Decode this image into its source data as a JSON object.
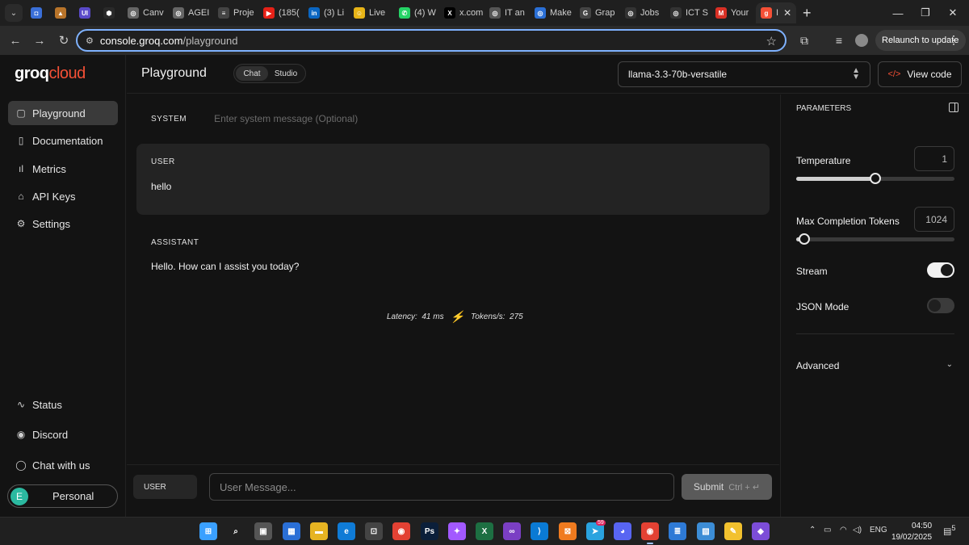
{
  "browser": {
    "tabs": [
      {
        "label": "",
        "color": "#3a6fd8",
        "glyph": "◘"
      },
      {
        "label": "",
        "color": "#b8742a",
        "glyph": "▲"
      },
      {
        "label": "",
        "color": "#5a4ac9",
        "glyph": "UI"
      },
      {
        "label": "",
        "color": "#2a2a2a",
        "glyph": "⬢"
      },
      {
        "label": "Canv",
        "color": "#666666",
        "glyph": "◎"
      },
      {
        "label": "AGEI",
        "color": "#666666",
        "glyph": "◎"
      },
      {
        "label": "Proje",
        "color": "#444444",
        "glyph": "≡"
      },
      {
        "label": "(185(",
        "color": "#e62117",
        "glyph": "▶"
      },
      {
        "label": "(3) Li",
        "color": "#0a66c2",
        "glyph": "in"
      },
      {
        "label": "Live",
        "color": "#e7b417",
        "glyph": "☺"
      },
      {
        "label": "(4) W",
        "color": "#25d366",
        "glyph": "✆"
      },
      {
        "label": "x.com",
        "color": "#000000",
        "glyph": "X"
      },
      {
        "label": "IT an",
        "color": "#555555",
        "glyph": "◎"
      },
      {
        "label": "Make",
        "color": "#2a6fd6",
        "glyph": "◎"
      },
      {
        "label": "Grap",
        "color": "#444444",
        "glyph": "G"
      },
      {
        "label": "Jobs",
        "color": "#333333",
        "glyph": "◎"
      },
      {
        "label": "ICT S",
        "color": "#333333",
        "glyph": "◎"
      },
      {
        "label": "Your",
        "color": "#d93025",
        "glyph": "M"
      },
      {
        "label": "I",
        "color": "#f55036",
        "glyph": "g",
        "active": true
      }
    ],
    "url_host": "console.groq.com",
    "url_path": "/playground",
    "relaunch_label": "Relaunch to update"
  },
  "app": {
    "logo_part1": "groq",
    "logo_part2": "cloud",
    "sidebar_items": [
      {
        "label": "Playground",
        "icon": "▢"
      },
      {
        "label": "Documentation",
        "icon": "▯"
      },
      {
        "label": "Metrics",
        "icon": "ıl"
      },
      {
        "label": "API Keys",
        "icon": "⌂"
      },
      {
        "label": "Settings",
        "icon": "⚙"
      }
    ],
    "sidebar_bottom": [
      {
        "label": "Status",
        "icon": "∿"
      },
      {
        "label": "Discord",
        "icon": "◉"
      },
      {
        "label": "Chat with us",
        "icon": "◯"
      }
    ],
    "account_initial": "E",
    "account_label": "Personal"
  },
  "header": {
    "title": "Playground",
    "modes": [
      "Chat",
      "Studio"
    ],
    "model": "llama-3.3-70b-versatile",
    "view_code": "View code",
    "view_code_icon": "</>"
  },
  "chat": {
    "system_role": "SYSTEM",
    "system_placeholder": "Enter system message (Optional)",
    "user_role": "USER",
    "user_message": "hello",
    "assistant_role": "ASSISTANT",
    "assistant_message": "Hello. How can I assist you today?",
    "latency_label": "Latency:",
    "latency_value": "41 ms",
    "tokens_label": "Tokens/s:",
    "tokens_value": "275"
  },
  "composer": {
    "role": "USER",
    "placeholder": "User Message...",
    "submit": "Submit",
    "shortcut": "Ctrl + ↵"
  },
  "params": {
    "title": "PARAMETERS",
    "temperature_label": "Temperature",
    "temperature_value": "1",
    "temperature_level": 0.5,
    "max_tokens_label": "Max Completion Tokens",
    "max_tokens_value": "1024",
    "max_tokens_level": 0.05,
    "stream_label": "Stream",
    "stream_on": true,
    "json_label": "JSON Mode",
    "json_on": false,
    "advanced_label": "Advanced"
  },
  "taskbar": {
    "apps": [
      {
        "name": "start",
        "color": "#3aa0ff",
        "glyph": "⊞"
      },
      {
        "name": "search",
        "color": "#202020",
        "glyph": "⌕"
      },
      {
        "name": "task-view",
        "color": "#555555",
        "glyph": "▣"
      },
      {
        "name": "widgets",
        "color": "#2a6fd6",
        "glyph": "▦"
      },
      {
        "name": "explorer",
        "color": "#e6b422",
        "glyph": "▬"
      },
      {
        "name": "edge",
        "color": "#0f7bd6",
        "glyph": "e"
      },
      {
        "name": "store",
        "color": "#444444",
        "glyph": "⊡"
      },
      {
        "name": "chrome",
        "color": "#e34133",
        "glyph": "◉"
      },
      {
        "name": "photoshop",
        "color": "#0b1f3a",
        "glyph": "Ps"
      },
      {
        "name": "figma",
        "color": "#a259ff",
        "glyph": "✦"
      },
      {
        "name": "excel",
        "color": "#1d6f42",
        "glyph": "X"
      },
      {
        "name": "visual-studio",
        "color": "#7b3fc4",
        "glyph": "∞"
      },
      {
        "name": "vscode",
        "color": "#0a7ad4",
        "glyph": "⟩"
      },
      {
        "name": "xampp",
        "color": "#f07b1f",
        "glyph": "⊠"
      },
      {
        "name": "telegram",
        "color": "#2aa3df",
        "glyph": "➤"
      },
      {
        "name": "discord",
        "color": "#5865f2",
        "glyph": "◕"
      },
      {
        "name": "chrome-active",
        "color": "#e34133",
        "glyph": "◉",
        "active": true
      },
      {
        "name": "notepad",
        "color": "#2e7ad6",
        "glyph": "≣"
      },
      {
        "name": "snipping",
        "color": "#3c8dd6",
        "glyph": "▧"
      },
      {
        "name": "sticky-notes",
        "color": "#f2c12e",
        "glyph": "✎"
      },
      {
        "name": "obsidian",
        "color": "#7c4dd8",
        "glyph": "◆"
      }
    ],
    "language": "ENG",
    "time": "04:50",
    "date": "19/02/2025",
    "notifications": "5",
    "telegram_badge": "59"
  }
}
